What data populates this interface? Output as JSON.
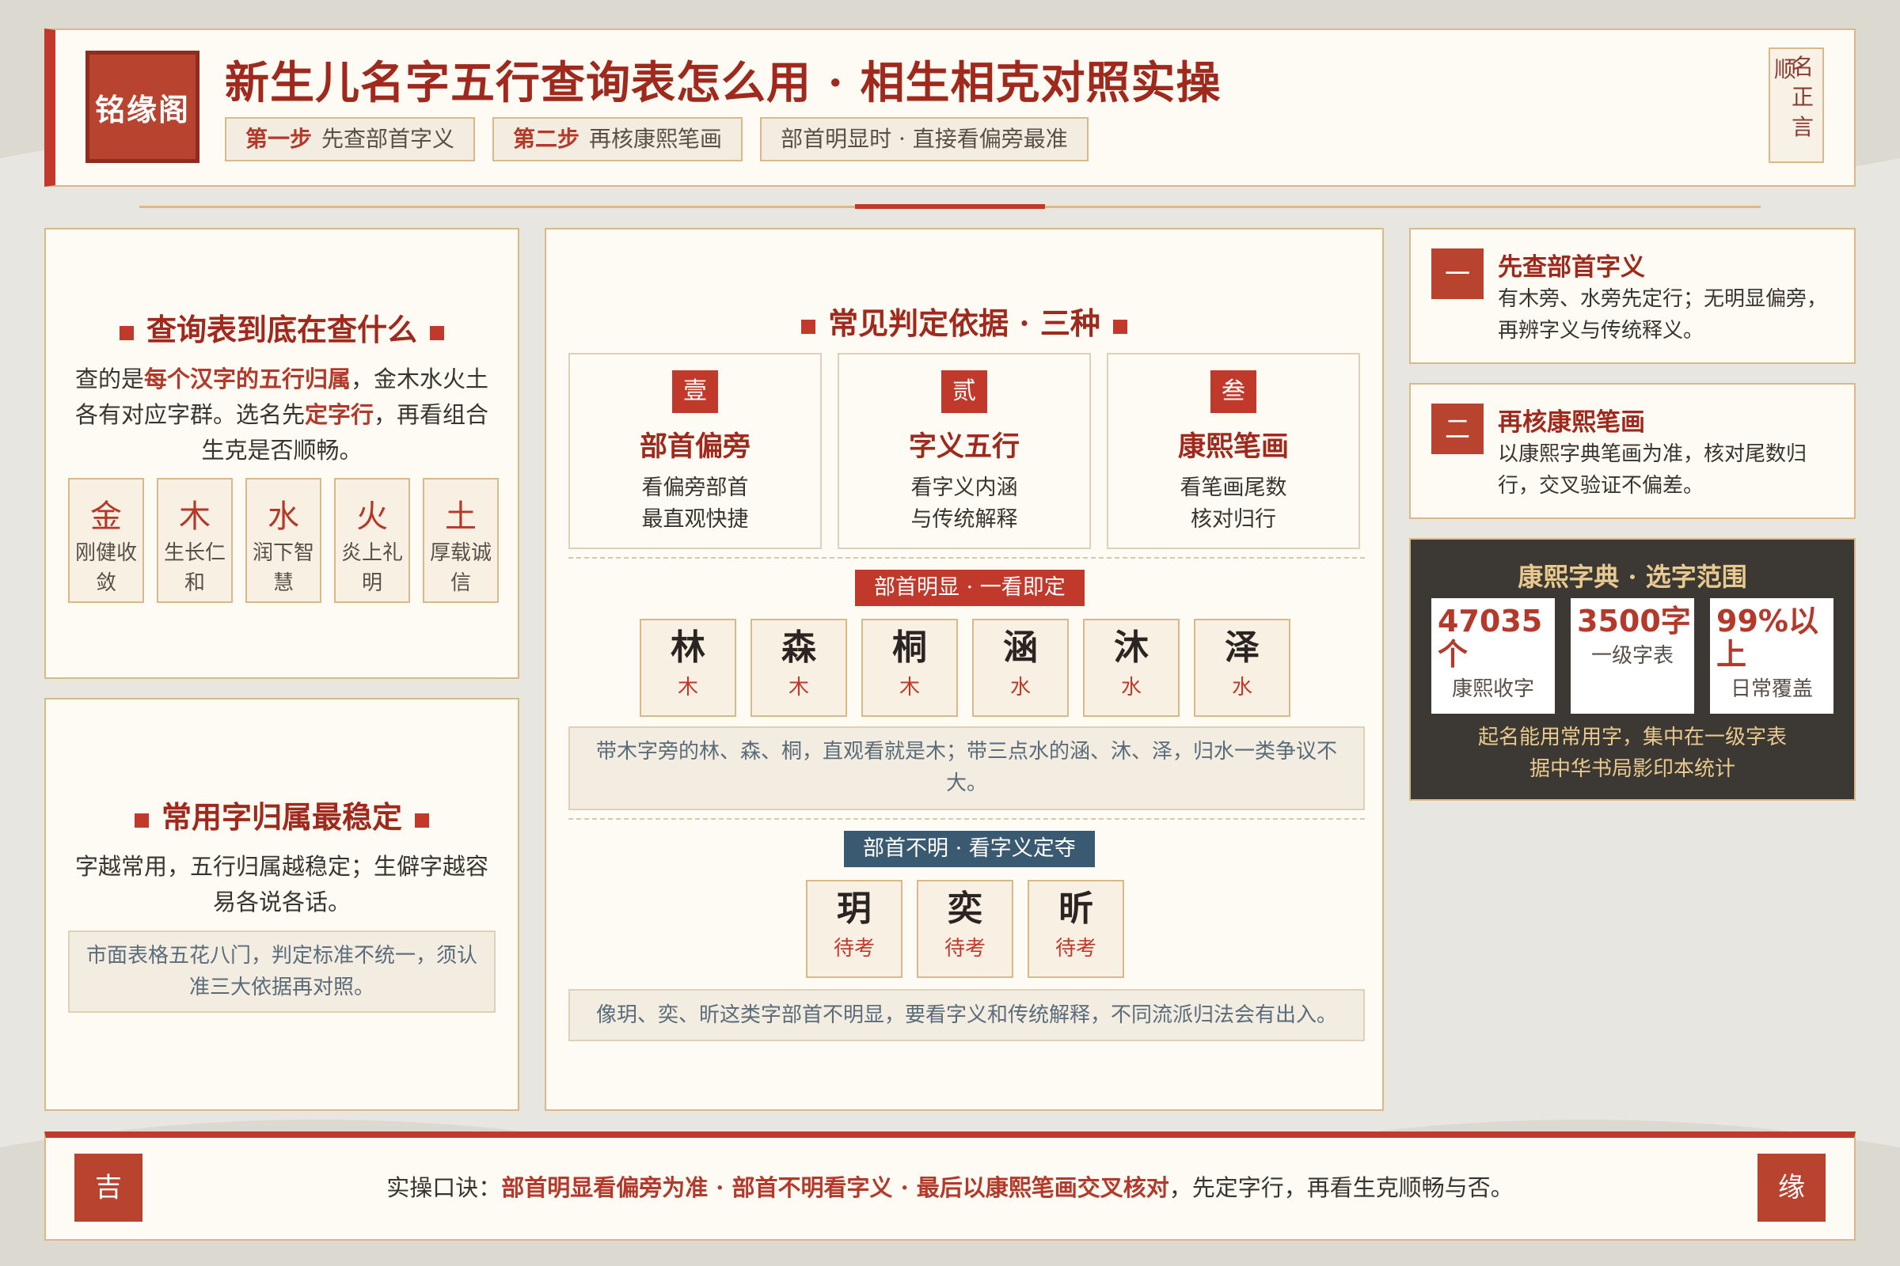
{
  "header": {
    "logo": "铭缘阁",
    "title": "新生儿名字五行查询表怎么用 · 相生相克对照实操",
    "tags": [
      {
        "strong": "第一步",
        "text": "先查部首字义"
      },
      {
        "strong": "第二步",
        "text": "再核康熙笔画"
      },
      {
        "strong": "",
        "text": "部首明显时 · 直接看偏旁最准"
      }
    ],
    "seal": {
      "col1": "名正言",
      "col2": "顺"
    }
  },
  "left1": {
    "title": "查询表到底在查什么",
    "p1": "查的是",
    "p1b": "每个汉字的五行归属",
    "p2": "，金木水火土各有对应字群。选名先",
    "p2b": "定字行",
    "p3": "，再看组合生克是否顺畅。",
    "elements": [
      {
        "char": "金",
        "desc": "刚健收敛"
      },
      {
        "char": "木",
        "desc": "生长仁和"
      },
      {
        "char": "水",
        "desc": "润下智慧"
      },
      {
        "char": "火",
        "desc": "炎上礼明"
      },
      {
        "char": "土",
        "desc": "厚载诚信"
      }
    ]
  },
  "left2": {
    "title": "常用字归属最稳定",
    "text": "字越常用，五行归属越稳定；生僻字越容易各说各话。",
    "note": "市面表格五花八门，判定标准不统一，须认准三大依据再对照。"
  },
  "center": {
    "title": "常见判定依据 · 三种",
    "basis": [
      {
        "badge": "壹",
        "title": "部首偏旁",
        "d1": "看偏旁部首",
        "d2": "最直观快捷"
      },
      {
        "badge": "贰",
        "title": "字义五行",
        "d1": "看字义内涵",
        "d2": "与传统解释"
      },
      {
        "badge": "叁",
        "title": "康熙笔画",
        "d1": "看笔画尾数",
        "d2": "核对归行"
      }
    ],
    "pill1": "部首明显 · 一看即定",
    "chars1": [
      {
        "char": "林",
        "el": "木"
      },
      {
        "char": "森",
        "el": "木"
      },
      {
        "char": "桐",
        "el": "木"
      },
      {
        "char": "涵",
        "el": "水"
      },
      {
        "char": "沐",
        "el": "水"
      },
      {
        "char": "泽",
        "el": "水"
      }
    ],
    "note1": "带木字旁的林、森、桐，直观看就是木；带三点水的涵、沐、泽，归水一类争议不大。",
    "pill2": "部首不明 · 看字义定夺",
    "chars2": [
      {
        "char": "玥",
        "el": "待考"
      },
      {
        "char": "奕",
        "el": "待考"
      },
      {
        "char": "昕",
        "el": "待考"
      }
    ],
    "note2": "像玥、奕、昕这类字部首不明显，要看字义和传统解释，不同流派归法会有出入。"
  },
  "right": {
    "steps": [
      {
        "badge": "一",
        "title": "先查部首字义",
        "desc": "有木旁、水旁先定行；无明显偏旁，再辨字义与传统释义。"
      },
      {
        "badge": "二",
        "title": "再核康熙笔画",
        "desc": "以康熙字典笔画为准，核对尾数归行，交叉验证不偏差。"
      }
    ],
    "dict": {
      "title": "康熙字典 · 选字范围",
      "stats": [
        {
          "num": "47035个",
          "label": "康熙收字"
        },
        {
          "num": "3500字",
          "label": "一级字表"
        },
        {
          "num": "99%以上",
          "label": "日常覆盖"
        }
      ],
      "f1": "起名能用常用字，集中在一级字表",
      "f2": "据中华书局影印本统计"
    }
  },
  "footer": {
    "seal_left": "吉",
    "seal_right": "缘",
    "prefix": "实操口诀：",
    "bold": "部首明显看偏旁为准 · 部首不明看字义 · 最后以康熙笔画交叉核对",
    "suffix": "，先定字行，再看生克顺畅与否。"
  },
  "colors": {
    "accent": "#c0392b",
    "border": "#d9b98a",
    "paper": "#fdfbf3",
    "dark": "#3c3833",
    "blue": "#3a5a72"
  }
}
